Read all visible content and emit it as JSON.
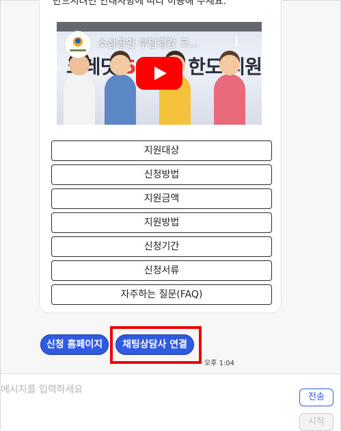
{
  "message": {
    "partial_text": "반으시려면 안내사항에 따라 이용해 주세요."
  },
  "video": {
    "title": "소상공인 부담경감 크...",
    "banner_prefix": "크레딧 ",
    "banner_amount": "50만원",
    "banner_suffix": " 한도 지원!",
    "more_icon": "more-vertical-icon",
    "play_icon": "play-icon",
    "play_color": "#ff0000"
  },
  "menu": [
    "지원대상",
    "신청방법",
    "지원금액",
    "지원방법",
    "신청기간",
    "신청서류",
    "자주하는 질문(FAQ)"
  ],
  "chips": {
    "homepage": "신청 홈페이지",
    "agent": "채팅상담사 연결"
  },
  "timestamp": "오후 1:04",
  "input": {
    "placeholder": "메시지를 입력하세요",
    "send_label": "전송",
    "start_label": "시작"
  },
  "colors": {
    "accent": "#2f5be0",
    "highlight": "#ee0000"
  }
}
